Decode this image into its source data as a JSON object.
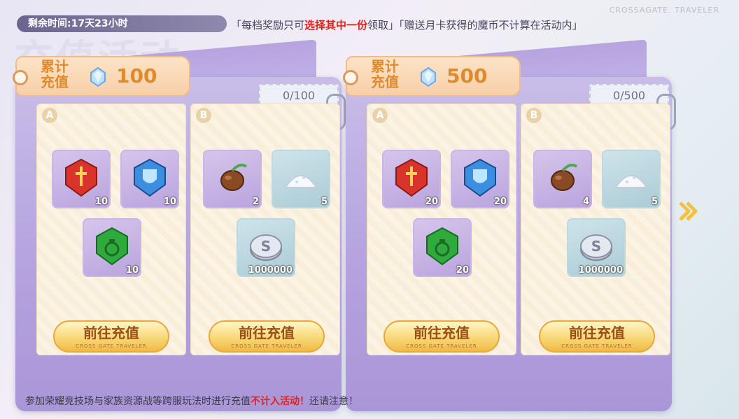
{
  "background_title": "充值活动",
  "watermark": "CROSSAGATE. TRAVELER",
  "timer": {
    "label": "剩余时间:17天23小时"
  },
  "notice": {
    "part1": "「每档奖励只可",
    "highlight": "选择其中一份",
    "part2": "领取」「赠送月卡获得的魔币不计算在活动内」"
  },
  "colors": {
    "accent_orange": "#e08a2e",
    "warning_red": "#e0211c",
    "button_gold": "#f8d877",
    "card_purple": "#b6a5e0"
  },
  "cards": [
    {
      "label": "累计\n充值",
      "amount": "100",
      "progress": "0/100",
      "panels": [
        {
          "letter": "A",
          "button": "前往充值",
          "button_sub": "CROSS GATE TRAVELER",
          "items": [
            {
              "icon": "red-sword-crystal-icon",
              "qty": "10"
            },
            {
              "icon": "blue-shield-crystal-icon",
              "qty": "10"
            },
            {
              "icon": "green-potion-crystal-icon",
              "qty": "10"
            }
          ]
        },
        {
          "letter": "B",
          "button": "前往充值",
          "button_sub": "CROSS GATE TRAVELER",
          "items": [
            {
              "icon": "seed-icon",
              "qty": "2"
            },
            {
              "icon": "salt-pile-icon",
              "qty": "5"
            },
            {
              "icon": "silver-coin-icon",
              "qty": "1000000"
            }
          ]
        }
      ]
    },
    {
      "label": "累计\n充值",
      "amount": "500",
      "progress": "0/500",
      "panels": [
        {
          "letter": "A",
          "button": "前往充值",
          "button_sub": "CROSS GATE TRAVELER",
          "items": [
            {
              "icon": "red-sword-crystal-icon",
              "qty": "20"
            },
            {
              "icon": "blue-shield-crystal-icon",
              "qty": "20"
            },
            {
              "icon": "green-potion-crystal-icon",
              "qty": "20"
            }
          ]
        },
        {
          "letter": "B",
          "button": "前往充值",
          "button_sub": "CROSS GATE TRAVELER",
          "items": [
            {
              "icon": "seed-icon",
              "qty": "4"
            },
            {
              "icon": "salt-pile-icon",
              "qty": "5"
            },
            {
              "icon": "silver-coin-icon",
              "qty": "1000000"
            }
          ]
        }
      ]
    }
  ],
  "bottom_note": {
    "part1": "参加荣耀竞技场与家族资源战等跨服玩法时进行充值",
    "highlight": "不计入活动！",
    "part2": "还请注意！"
  }
}
